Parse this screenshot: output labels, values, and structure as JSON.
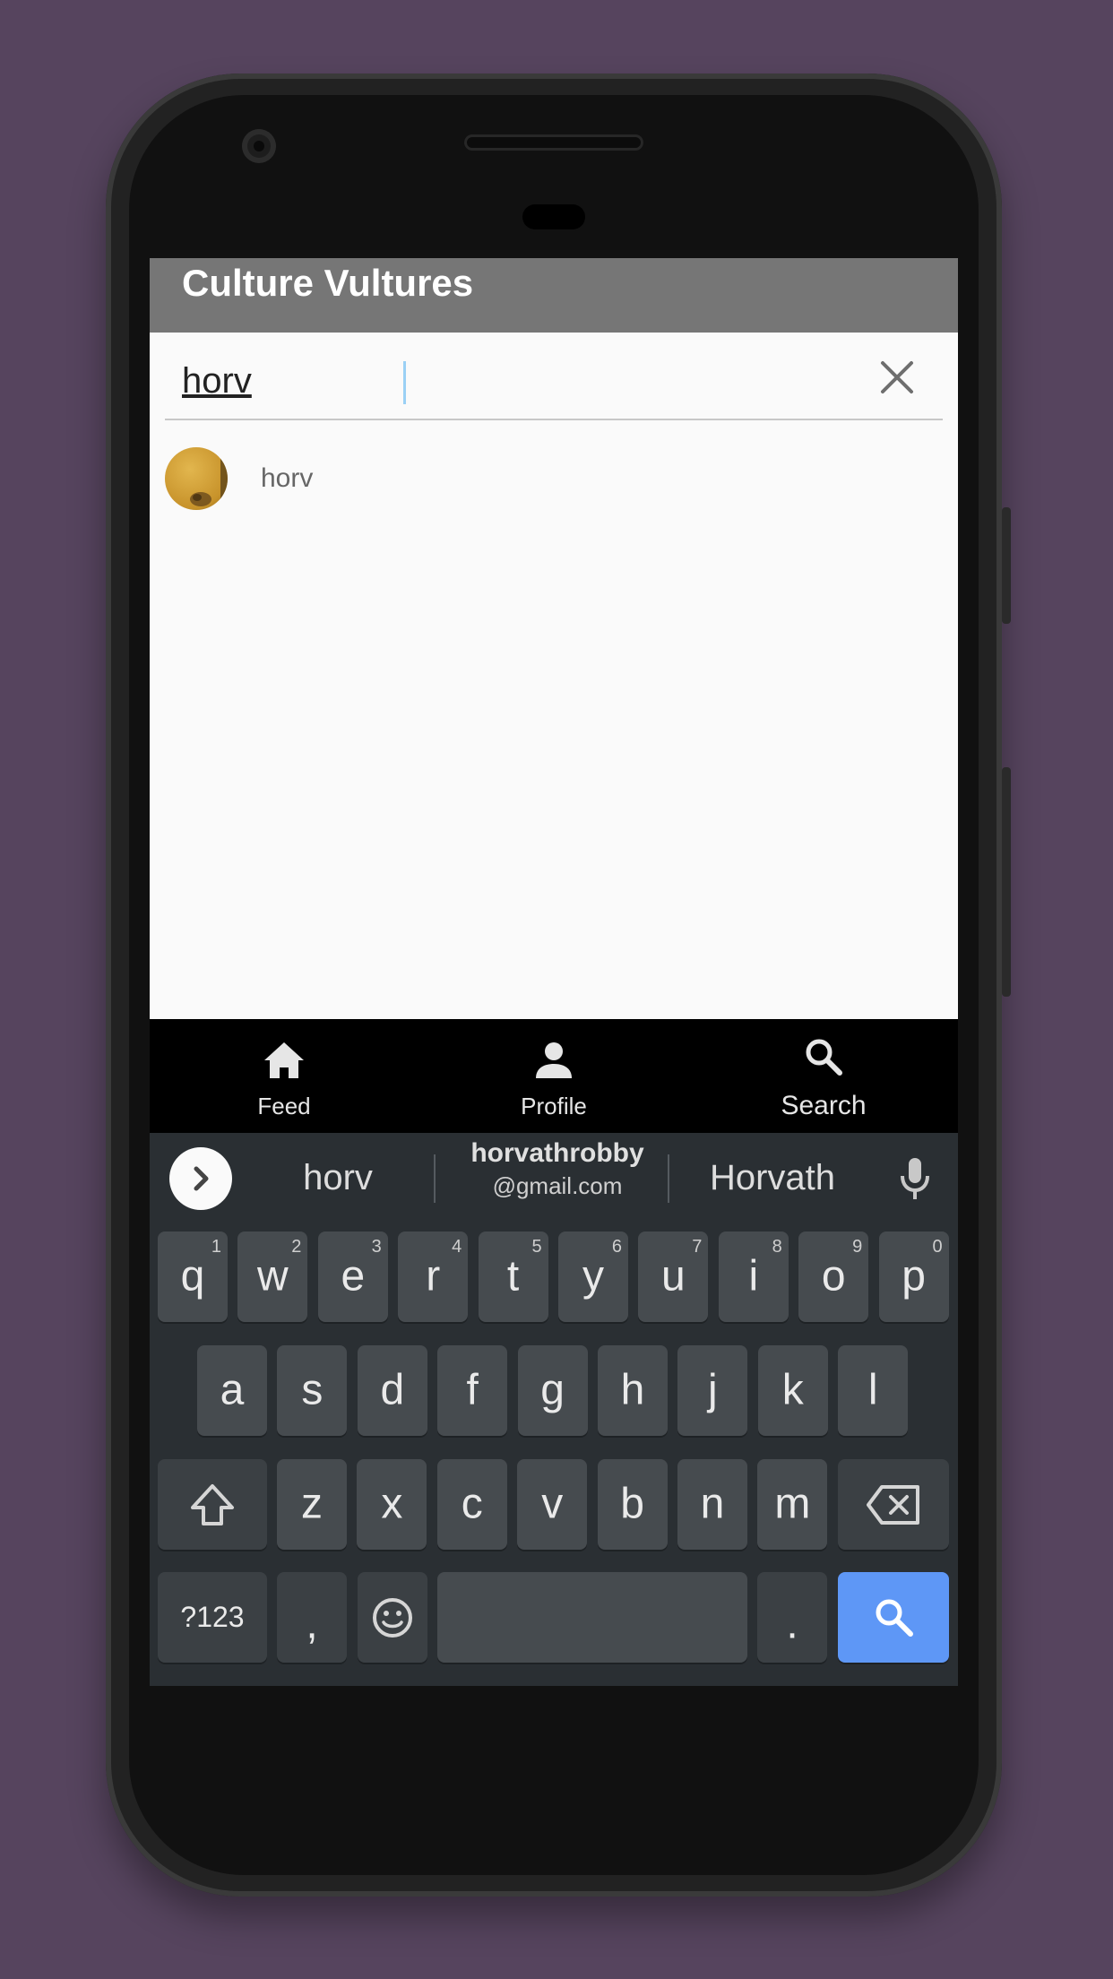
{
  "app": {
    "title": "Culture Vultures"
  },
  "search": {
    "value": "horv",
    "clear_icon": "close-icon"
  },
  "results": [
    {
      "label": "horv",
      "avatar": "user-avatar"
    }
  ],
  "bottom_nav": {
    "items": [
      {
        "label": "Feed",
        "icon": "home-icon"
      },
      {
        "label": "Profile",
        "icon": "person-icon"
      },
      {
        "label": "Search",
        "icon": "search-icon"
      }
    ]
  },
  "keyboard": {
    "suggestions": {
      "left": "horv",
      "middle_line1": "horvathrobby",
      "middle_line2": "@gmail.com",
      "right": "Horvath"
    },
    "row1": [
      {
        "k": "q",
        "h": "1"
      },
      {
        "k": "w",
        "h": "2"
      },
      {
        "k": "e",
        "h": "3"
      },
      {
        "k": "r",
        "h": "4"
      },
      {
        "k": "t",
        "h": "5"
      },
      {
        "k": "y",
        "h": "6"
      },
      {
        "k": "u",
        "h": "7"
      },
      {
        "k": "i",
        "h": "8"
      },
      {
        "k": "o",
        "h": "9"
      },
      {
        "k": "p",
        "h": "0"
      }
    ],
    "row2": [
      "a",
      "s",
      "d",
      "f",
      "g",
      "h",
      "j",
      "k",
      "l"
    ],
    "row3": [
      "z",
      "x",
      "c",
      "v",
      "b",
      "n",
      "m"
    ],
    "row4": {
      "symbols": "?123",
      "comma": ",",
      "period": "."
    },
    "colors": {
      "search_key": "#5e97f6",
      "key": "#464b4f",
      "background": "#2a2f33"
    }
  },
  "colors": {
    "background": "#56445e",
    "appbar": "#767676",
    "content": "#fafafa"
  }
}
